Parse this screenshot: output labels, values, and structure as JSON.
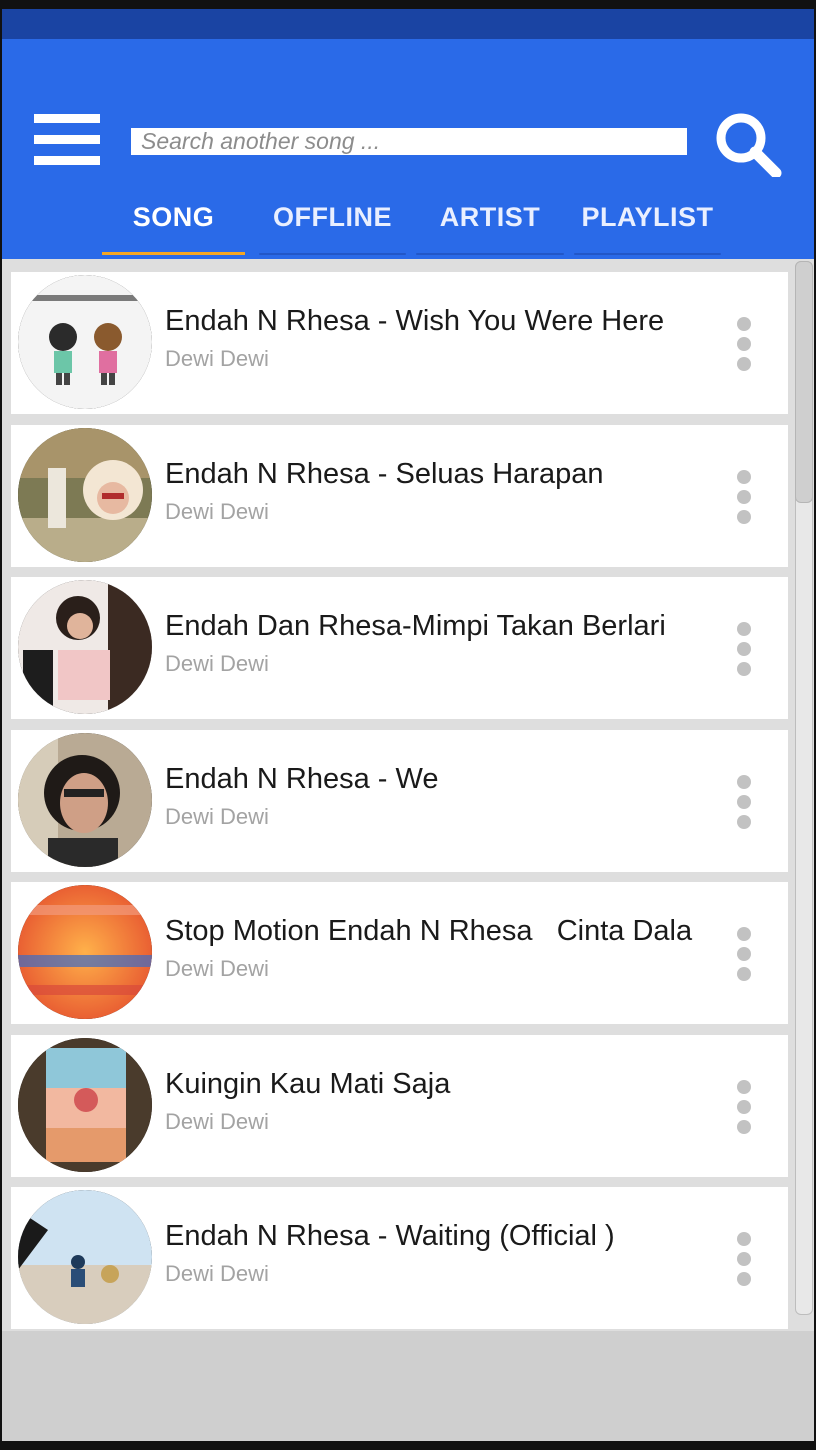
{
  "colors": {
    "status_bar": "#1a44a3",
    "app_bar": "#2a6ae8",
    "tab_indicator": "#f5a623",
    "artist_text": "#a3a3a3"
  },
  "header": {
    "menu_icon": "hamburger-menu-icon",
    "search": {
      "placeholder": "Search another song ...",
      "value": ""
    },
    "search_icon": "magnifier-icon"
  },
  "tabs": [
    {
      "label": "SONG",
      "active": true
    },
    {
      "label": "OFFLINE",
      "active": false
    },
    {
      "label": "ARTIST",
      "active": false
    },
    {
      "label": "PLAYLIST",
      "active": false
    }
  ],
  "songs": [
    {
      "title": "Endah N Rhesa - Wish You Were Here",
      "artist": "Dewi Dewi"
    },
    {
      "title": "Endah N Rhesa - Seluas Harapan",
      "artist": "Dewi Dewi"
    },
    {
      "title": "Endah Dan Rhesa-Mimpi Takan Berlari",
      "artist": "Dewi Dewi"
    },
    {
      "title": "Endah N Rhesa - We",
      "artist": "Dewi Dewi"
    },
    {
      "title": "Stop Motion Endah N Rhesa   Cinta Dala",
      "artist": "Dewi Dewi"
    },
    {
      "title": "Kuingin Kau Mati Saja",
      "artist": "Dewi Dewi"
    },
    {
      "title": "Endah N Rhesa - Waiting (Official )",
      "artist": "Dewi Dewi"
    }
  ],
  "row_more_icon": "vertical-dots-icon"
}
